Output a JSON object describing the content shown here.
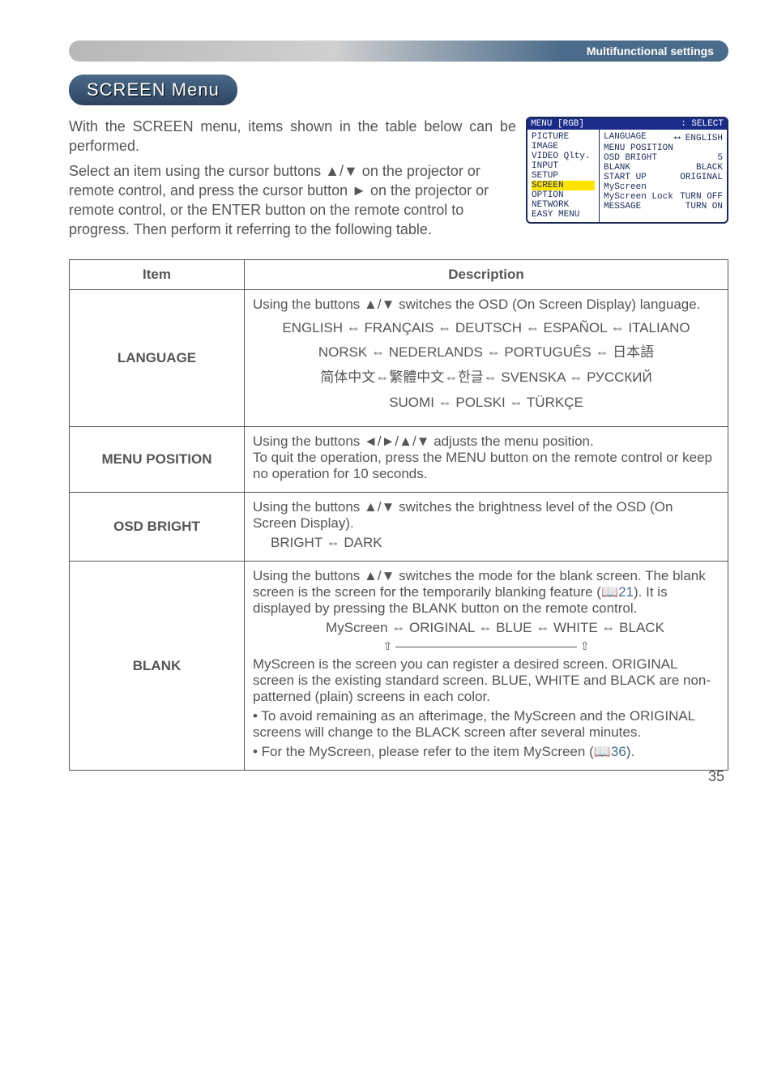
{
  "section_header": "Multifunctional settings",
  "menu_title": "SCREEN Menu",
  "intro_p1": "With the SCREEN menu, items shown in the table below can be performed.",
  "intro_p2": "Select an item using the cursor buttons ▲/▼ on the projector or remote control, and press the cursor button ► on the projector or remote control, or the ENTER button on the remote control to progress. Then perform it referring to the following table.",
  "osd": {
    "title_left": "MENU [RGB]",
    "title_right": ": SELECT",
    "left_items": [
      "PICTURE",
      "IMAGE",
      "VIDEO Qlty.",
      "INPUT",
      "SETUP",
      "SCREEN",
      "OPTION",
      "NETWORK",
      "EASY MENU"
    ],
    "right_rows": [
      {
        "l": "LANGUAGE",
        "r": "⟷ ENGLISH"
      },
      {
        "l": "MENU POSITION",
        "r": ""
      },
      {
        "l": "OSD BRIGHT",
        "r": "5"
      },
      {
        "l": "BLANK",
        "r": "BLACK"
      },
      {
        "l": "START UP",
        "r": "ORIGINAL"
      },
      {
        "l": "MyScreen",
        "r": ""
      },
      {
        "l": "MyScreen Lock",
        "r": "TURN OFF"
      },
      {
        "l": "MESSAGE",
        "r": "TURN ON"
      }
    ]
  },
  "table": {
    "h_item": "Item",
    "h_desc": "Description",
    "rows": {
      "language": {
        "name": "LANGUAGE",
        "line1": "Using the buttons ▲/▼ switches the OSD (On Screen Display) language.",
        "flow1": "ENGLISH ⇔ FRANÇAIS ⇔ DEUTSCH ⇔ ESPAÑOL ⇔ ITALIANO",
        "flow2": "NORSK ⇔ NEDERLANDS ⇔ PORTUGUÊS ⇔ 日本語",
        "flow3": "简体中文⇔繁體中文⇔한글⇔ SVENSKA ⇔ РУССКИЙ",
        "flow4": "SUOMI ⇔ POLSKI ⇔ TÜRKÇE"
      },
      "menu_position": {
        "name": "MENU POSITION",
        "text": "Using the buttons ◄/►/▲/▼ adjusts the menu position.\nTo quit the operation, press the MENU button on the remote control or keep no operation for 10 seconds."
      },
      "osd_bright": {
        "name": "OSD BRIGHT",
        "line1": "Using the buttons ▲/▼ switches the brightness level of the OSD (On Screen Display).",
        "line2": "BRIGHT ⇔ DARK"
      },
      "blank": {
        "name": "BLANK",
        "p1a": "Using the buttons ▲/▼ switches the mode for the blank screen. The blank screen is the screen for the temporarily blanking feature (",
        "p1ref": "📖21",
        "p1b": "). It is displayed by pressing the BLANK button on the remote control.",
        "flow": "MyScreen ⇔ ORIGINAL ⇔ BLUE ⇔ WHITE ⇔ BLACK",
        "p2": "MyScreen is the screen you can register a desired screen. ORIGINAL screen is the existing standard screen. BLUE, WHITE and BLACK are non-patterned (plain) screens in each color.",
        "p3": "• To avoid remaining as an afterimage, the MyScreen and the ORIGINAL screens will change to the BLACK screen after several minutes.",
        "p4a": "• For the MyScreen, please refer to the item MyScreen (",
        "p4ref": "📖36",
        "p4b": ")."
      }
    }
  },
  "page_num": "35"
}
